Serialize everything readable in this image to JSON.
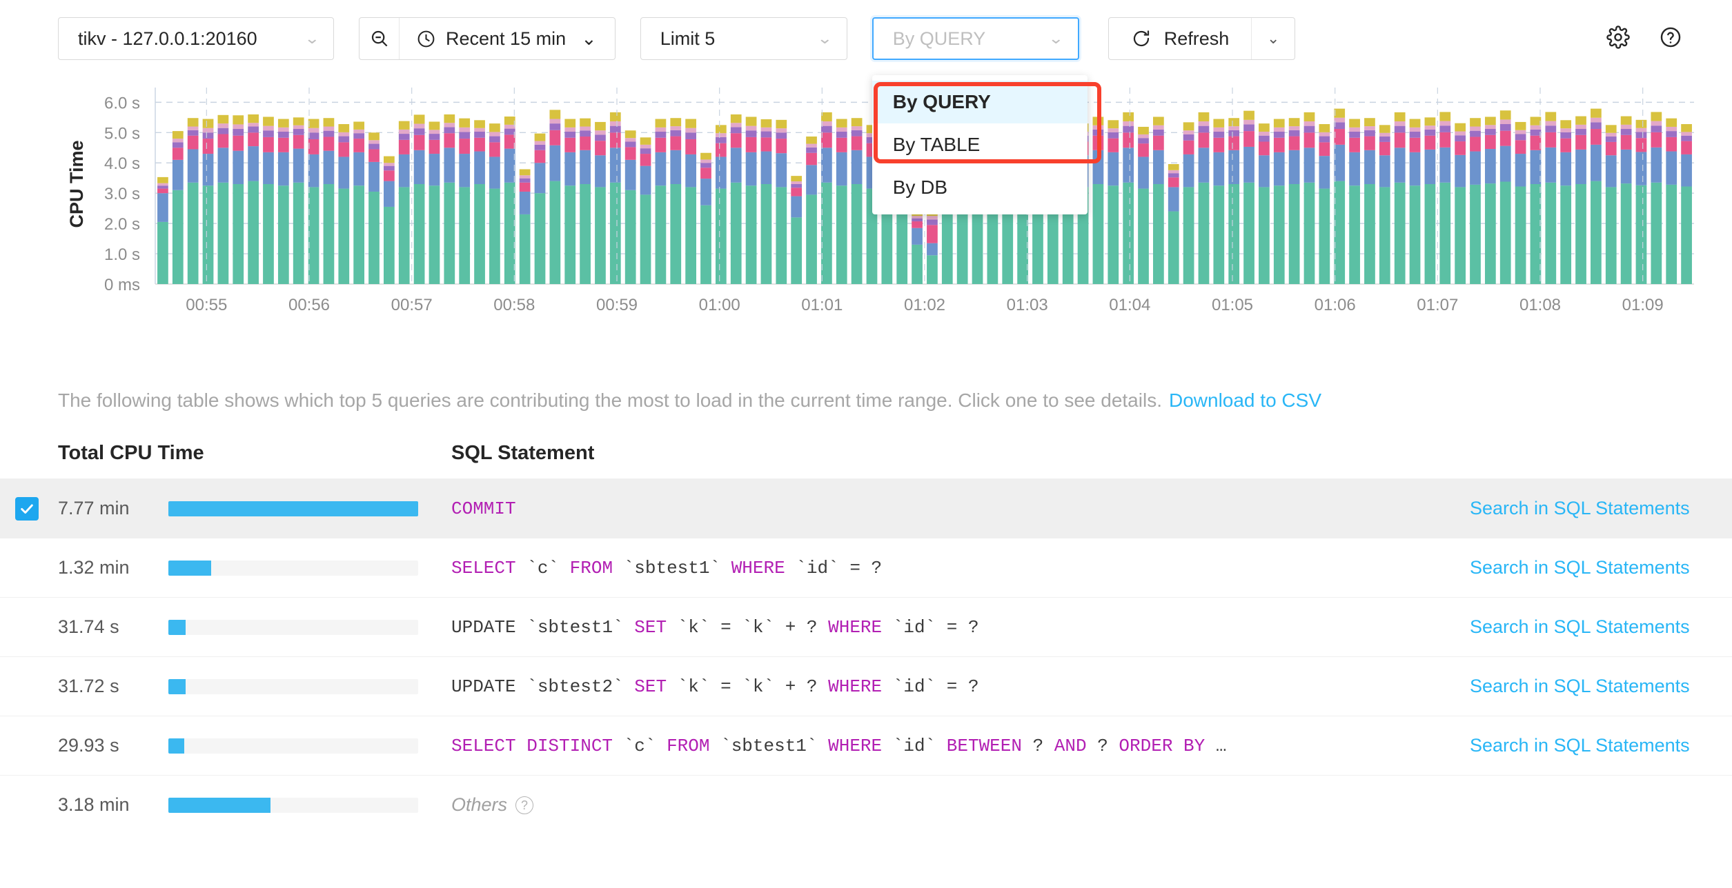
{
  "toolbar": {
    "instance": {
      "value": "tikv - 127.0.0.1:20160",
      "caret": "chevron-down-icon"
    },
    "zoom_out": {
      "icon": "zoom-out-icon"
    },
    "time_range": {
      "icon": "clock-icon",
      "value": "Recent 15 min",
      "caret": "chevron-down-icon"
    },
    "limit": {
      "value": "Limit 5",
      "caret": "chevron-down-icon"
    },
    "group_by": {
      "placeholder": "By QUERY",
      "value": "",
      "caret": "chevron-down-icon",
      "options": [
        "By QUERY",
        "By TABLE",
        "By DB"
      ],
      "selected_option": "By QUERY",
      "highlight_color": "#f8402c",
      "focus_color": "#40a9ff"
    },
    "refresh": {
      "icon": "refresh-icon",
      "label": "Refresh",
      "caret": "chevron-down-icon"
    },
    "settings_icon": "gear-icon",
    "help_icon": "question-circle-icon"
  },
  "description": {
    "text": "The following table shows which top 5 queries are contributing the most to load in the current time range. Click one to see details.",
    "link": "Download to CSV"
  },
  "table": {
    "columns": [
      "Total CPU Time",
      "SQL Statement"
    ],
    "link_label": "Search in SQL Statements",
    "rows": [
      {
        "cpu": "7.77 min",
        "bar_pct": 100,
        "selected": true,
        "checked": true,
        "sql_tokens": [
          {
            "t": "COMMIT",
            "k": "kw"
          }
        ]
      },
      {
        "cpu": "1.32 min",
        "bar_pct": 17,
        "selected": false,
        "checked": false,
        "sql_tokens": [
          {
            "t": "SELECT",
            "k": "kw"
          },
          {
            "t": " `c` ",
            "k": "plain"
          },
          {
            "t": "FROM",
            "k": "kw"
          },
          {
            "t": " `sbtest1` ",
            "k": "plain"
          },
          {
            "t": "WHERE",
            "k": "kw"
          },
          {
            "t": " `id` = ?",
            "k": "plain"
          }
        ]
      },
      {
        "cpu": "31.74 s",
        "bar_pct": 6.8,
        "selected": false,
        "checked": false,
        "sql_tokens": [
          {
            "t": "UPDATE",
            "k": "plain"
          },
          {
            "t": " `sbtest1` ",
            "k": "plain"
          },
          {
            "t": "SET",
            "k": "kw"
          },
          {
            "t": " `k` = `k` + ? ",
            "k": "plain"
          },
          {
            "t": "WHERE",
            "k": "kw"
          },
          {
            "t": " `id` = ?",
            "k": "plain"
          }
        ]
      },
      {
        "cpu": "31.72 s",
        "bar_pct": 6.8,
        "selected": false,
        "checked": false,
        "sql_tokens": [
          {
            "t": "UPDATE",
            "k": "plain"
          },
          {
            "t": " `sbtest2` ",
            "k": "plain"
          },
          {
            "t": "SET",
            "k": "kw"
          },
          {
            "t": " `k` = `k` + ? ",
            "k": "plain"
          },
          {
            "t": "WHERE",
            "k": "kw"
          },
          {
            "t": " `id` = ?",
            "k": "plain"
          }
        ]
      },
      {
        "cpu": "29.93 s",
        "bar_pct": 6.4,
        "selected": false,
        "checked": false,
        "sql_tokens": [
          {
            "t": "SELECT DISTINCT",
            "k": "kw"
          },
          {
            "t": " `c` ",
            "k": "plain"
          },
          {
            "t": "FROM",
            "k": "kw"
          },
          {
            "t": " `sbtest1` ",
            "k": "plain"
          },
          {
            "t": "WHERE",
            "k": "kw"
          },
          {
            "t": " `id` ",
            "k": "plain"
          },
          {
            "t": "BETWEEN",
            "k": "kw"
          },
          {
            "t": " ? ",
            "k": "plain"
          },
          {
            "t": "AND",
            "k": "kw"
          },
          {
            "t": " ? ",
            "k": "plain"
          },
          {
            "t": "ORDER BY",
            "k": "kw"
          },
          {
            "t": " …",
            "k": "plain"
          }
        ]
      }
    ],
    "others_row": {
      "cpu": "3.18 min",
      "bar_pct": 41,
      "label": "Others",
      "help_icon": "question-circle-icon"
    }
  },
  "chart_data": {
    "type": "bar",
    "stacked": true,
    "title": "",
    "xlabel": "",
    "ylabel": "CPU Time",
    "ytick_labels": [
      "0 ms",
      "1.0 s",
      "2.0 s",
      "3.0 s",
      "4.0 s",
      "5.0 s",
      "6.0 s"
    ],
    "ytick_values": [
      0,
      1,
      2,
      3,
      4,
      5,
      6
    ],
    "ylim": [
      0,
      6.6
    ],
    "xtick_labels": [
      "00:55",
      "00:56",
      "00:57",
      "00:58",
      "00:59",
      "01:00",
      "01:01",
      "01:02",
      "01:03",
      "01:04",
      "01:05",
      "01:06",
      "01:07",
      "01:08",
      "01:09"
    ],
    "grid": true,
    "legend": "none",
    "series": [
      {
        "name": "COMMIT",
        "color": "#5bc0a4"
      },
      {
        "name": "SELECT `c` FROM `sbtest1` WHERE `id` = ?",
        "color": "#6c93cd"
      },
      {
        "name": "UPDATE `sbtest1` SET `k` = `k` + ? WHERE `id` = ?",
        "color": "#e8548a"
      },
      {
        "name": "UPDATE `sbtest2` SET `k` = `k` + ? WHERE `id` = ?",
        "color": "#9b6fc4"
      },
      {
        "name": "SELECT DISTINCT `c` FROM `sbtest1` WHERE `id` BETWEEN ? AND ? ORDER BY …",
        "color": "#e3a8c9"
      },
      {
        "name": "Others",
        "color": "#d8c23f"
      }
    ],
    "values": [
      [
        2.05,
        0.95,
        0.15,
        0.1,
        0.08,
        0.2
      ],
      [
        3.1,
        1.0,
        0.4,
        0.18,
        0.12,
        0.25
      ],
      [
        3.35,
        1.1,
        0.45,
        0.18,
        0.12,
        0.28
      ],
      [
        3.25,
        1.05,
        0.5,
        0.2,
        0.15,
        0.3
      ],
      [
        3.35,
        1.15,
        0.45,
        0.2,
        0.15,
        0.28
      ],
      [
        3.3,
        1.1,
        0.5,
        0.22,
        0.15,
        0.3
      ],
      [
        3.4,
        1.15,
        0.45,
        0.2,
        0.12,
        0.28
      ],
      [
        3.3,
        1.05,
        0.5,
        0.22,
        0.15,
        0.3
      ],
      [
        3.25,
        1.1,
        0.48,
        0.2,
        0.14,
        0.28
      ],
      [
        3.35,
        1.12,
        0.45,
        0.2,
        0.12,
        0.26
      ],
      [
        3.2,
        1.08,
        0.5,
        0.22,
        0.15,
        0.3
      ],
      [
        3.3,
        1.1,
        0.46,
        0.2,
        0.14,
        0.28
      ],
      [
        3.15,
        1.05,
        0.48,
        0.2,
        0.13,
        0.27
      ],
      [
        3.25,
        1.1,
        0.45,
        0.18,
        0.12,
        0.26
      ],
      [
        3.05,
        0.98,
        0.42,
        0.18,
        0.12,
        0.25
      ],
      [
        2.55,
        0.85,
        0.35,
        0.15,
        0.1,
        0.22
      ],
      [
        3.2,
        1.08,
        0.48,
        0.2,
        0.14,
        0.28
      ],
      [
        3.3,
        1.12,
        0.5,
        0.22,
        0.15,
        0.3
      ],
      [
        3.25,
        1.05,
        0.46,
        0.2,
        0.13,
        0.27
      ],
      [
        3.35,
        1.15,
        0.48,
        0.2,
        0.14,
        0.28
      ],
      [
        3.2,
        1.1,
        0.5,
        0.22,
        0.15,
        0.3
      ],
      [
        3.3,
        1.08,
        0.45,
        0.2,
        0.12,
        0.26
      ],
      [
        3.15,
        1.05,
        0.48,
        0.2,
        0.14,
        0.28
      ],
      [
        3.35,
        1.12,
        0.46,
        0.2,
        0.13,
        0.27
      ],
      [
        2.3,
        0.75,
        0.3,
        0.14,
        0.1,
        0.2
      ],
      [
        3.0,
        1.0,
        0.42,
        0.18,
        0.12,
        0.25
      ],
      [
        3.4,
        1.18,
        0.5,
        0.22,
        0.15,
        0.3
      ],
      [
        3.25,
        1.1,
        0.48,
        0.2,
        0.14,
        0.28
      ],
      [
        3.3,
        1.12,
        0.45,
        0.2,
        0.13,
        0.27
      ],
      [
        3.2,
        1.05,
        0.48,
        0.2,
        0.14,
        0.28
      ],
      [
        3.35,
        1.15,
        0.5,
        0.22,
        0.15,
        0.3
      ],
      [
        3.1,
        1.0,
        0.42,
        0.18,
        0.12,
        0.25
      ],
      [
        2.95,
        0.95,
        0.4,
        0.18,
        0.12,
        0.24
      ],
      [
        3.25,
        1.1,
        0.48,
        0.2,
        0.14,
        0.28
      ],
      [
        3.3,
        1.12,
        0.46,
        0.2,
        0.13,
        0.27
      ],
      [
        3.2,
        1.08,
        0.5,
        0.22,
        0.15,
        0.3
      ],
      [
        2.6,
        0.88,
        0.36,
        0.16,
        0.11,
        0.22
      ],
      [
        3.15,
        1.05,
        0.45,
        0.2,
        0.13,
        0.27
      ],
      [
        3.35,
        1.15,
        0.48,
        0.2,
        0.14,
        0.28
      ],
      [
        3.25,
        1.1,
        0.5,
        0.22,
        0.15,
        0.3
      ],
      [
        3.3,
        1.08,
        0.46,
        0.2,
        0.13,
        0.27
      ],
      [
        3.2,
        1.12,
        0.48,
        0.2,
        0.14,
        0.28
      ],
      [
        2.2,
        0.7,
        0.28,
        0.12,
        0.09,
        0.18
      ],
      [
        2.95,
        0.98,
        0.4,
        0.18,
        0.12,
        0.24
      ],
      [
        3.35,
        1.15,
        0.5,
        0.22,
        0.15,
        0.3
      ],
      [
        3.25,
        1.1,
        0.48,
        0.2,
        0.14,
        0.28
      ],
      [
        3.3,
        1.12,
        0.46,
        0.2,
        0.13,
        0.27
      ],
      [
        3.15,
        1.05,
        0.45,
        0.2,
        0.13,
        0.27
      ],
      [
        3.35,
        1.18,
        0.5,
        0.22,
        0.15,
        0.3
      ],
      [
        3.1,
        1.02,
        0.42,
        0.18,
        0.12,
        0.25
      ],
      [
        1.3,
        0.55,
        0.22,
        0.1,
        0.08,
        0.15
      ],
      [
        0.95,
        0.4,
        0.6,
        0.18,
        0.12,
        0.2
      ],
      [
        3.3,
        1.1,
        0.48,
        0.2,
        0.14,
        0.28
      ],
      [
        3.35,
        1.15,
        0.5,
        0.22,
        0.15,
        0.3
      ],
      [
        3.25,
        1.12,
        0.46,
        0.2,
        0.13,
        0.27
      ],
      [
        3.4,
        1.18,
        0.52,
        0.22,
        0.15,
        0.3
      ],
      [
        3.2,
        1.08,
        0.48,
        0.2,
        0.14,
        0.28
      ],
      [
        3.35,
        1.15,
        0.5,
        0.22,
        0.15,
        0.3
      ],
      [
        3.3,
        1.1,
        0.46,
        0.2,
        0.13,
        0.27
      ],
      [
        3.25,
        1.12,
        0.48,
        0.2,
        0.14,
        0.28
      ],
      [
        3.35,
        1.18,
        0.5,
        0.22,
        0.15,
        0.3
      ],
      [
        3.2,
        1.05,
        0.45,
        0.2,
        0.13,
        0.27
      ],
      [
        3.3,
        1.12,
        0.48,
        0.2,
        0.14,
        0.28
      ],
      [
        3.25,
        1.1,
        0.46,
        0.2,
        0.13,
        0.27
      ],
      [
        3.35,
        1.15,
        0.5,
        0.22,
        0.15,
        0.3
      ],
      [
        3.15,
        1.05,
        0.44,
        0.18,
        0.12,
        0.25
      ],
      [
        3.3,
        1.12,
        0.48,
        0.2,
        0.14,
        0.28
      ],
      [
        2.4,
        0.8,
        0.32,
        0.14,
        0.1,
        0.2
      ],
      [
        3.2,
        1.08,
        0.46,
        0.2,
        0.13,
        0.27
      ],
      [
        3.35,
        1.15,
        0.5,
        0.22,
        0.15,
        0.3
      ],
      [
        3.25,
        1.1,
        0.48,
        0.2,
        0.14,
        0.28
      ],
      [
        3.3,
        1.12,
        0.46,
        0.2,
        0.13,
        0.27
      ],
      [
        3.35,
        1.18,
        0.52,
        0.22,
        0.15,
        0.3
      ],
      [
        3.2,
        1.05,
        0.45,
        0.2,
        0.13,
        0.27
      ],
      [
        3.25,
        1.1,
        0.48,
        0.2,
        0.14,
        0.28
      ],
      [
        3.3,
        1.12,
        0.46,
        0.2,
        0.13,
        0.27
      ],
      [
        3.35,
        1.15,
        0.5,
        0.22,
        0.15,
        0.3
      ],
      [
        3.15,
        1.08,
        0.45,
        0.2,
        0.13,
        0.27
      ],
      [
        3.4,
        1.2,
        0.52,
        0.22,
        0.15,
        0.3
      ],
      [
        3.25,
        1.1,
        0.48,
        0.2,
        0.14,
        0.28
      ],
      [
        3.3,
        1.12,
        0.46,
        0.2,
        0.13,
        0.27
      ],
      [
        3.2,
        1.05,
        0.44,
        0.18,
        0.12,
        0.26
      ],
      [
        3.35,
        1.15,
        0.5,
        0.22,
        0.15,
        0.3
      ],
      [
        3.25,
        1.1,
        0.48,
        0.2,
        0.14,
        0.28
      ],
      [
        3.3,
        1.14,
        0.46,
        0.2,
        0.13,
        0.27
      ],
      [
        3.35,
        1.16,
        0.5,
        0.22,
        0.15,
        0.3
      ],
      [
        3.2,
        1.06,
        0.45,
        0.2,
        0.13,
        0.27
      ],
      [
        3.28,
        1.1,
        0.48,
        0.2,
        0.14,
        0.28
      ],
      [
        3.32,
        1.14,
        0.46,
        0.2,
        0.13,
        0.27
      ],
      [
        3.38,
        1.18,
        0.5,
        0.22,
        0.15,
        0.3
      ],
      [
        3.22,
        1.08,
        0.45,
        0.2,
        0.13,
        0.27
      ],
      [
        3.3,
        1.12,
        0.48,
        0.2,
        0.14,
        0.28
      ],
      [
        3.35,
        1.16,
        0.5,
        0.22,
        0.15,
        0.3
      ],
      [
        3.25,
        1.1,
        0.46,
        0.2,
        0.13,
        0.27
      ],
      [
        3.3,
        1.14,
        0.48,
        0.2,
        0.14,
        0.28
      ],
      [
        3.4,
        1.2,
        0.52,
        0.22,
        0.15,
        0.3
      ],
      [
        3.2,
        1.05,
        0.44,
        0.18,
        0.12,
        0.26
      ],
      [
        3.32,
        1.12,
        0.48,
        0.2,
        0.14,
        0.28
      ],
      [
        3.26,
        1.1,
        0.46,
        0.2,
        0.13,
        0.27
      ],
      [
        3.35,
        1.16,
        0.5,
        0.22,
        0.15,
        0.3
      ],
      [
        3.28,
        1.1,
        0.47,
        0.2,
        0.14,
        0.28
      ],
      [
        3.22,
        1.06,
        0.44,
        0.18,
        0.12,
        0.26
      ]
    ]
  }
}
